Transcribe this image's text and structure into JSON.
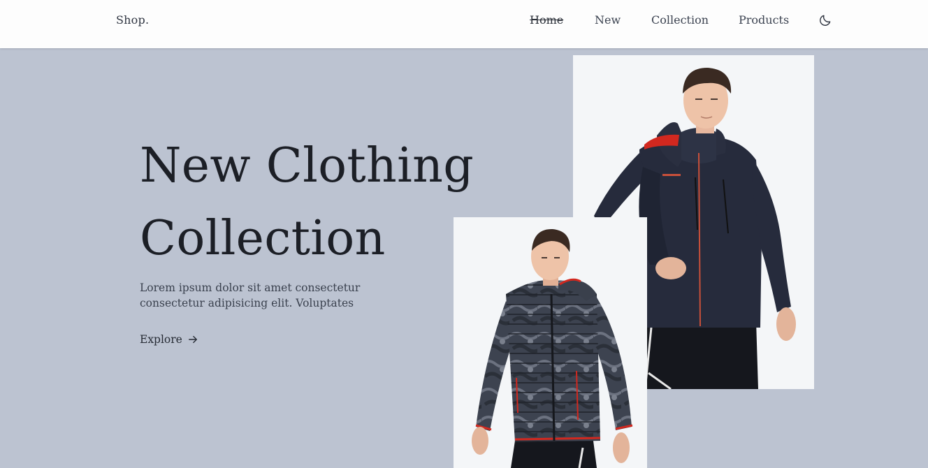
{
  "header": {
    "logo": "Shop.",
    "nav": [
      {
        "label": "Home",
        "active": true
      },
      {
        "label": "New",
        "active": false
      },
      {
        "label": "Collection",
        "active": false
      },
      {
        "label": "Products",
        "active": false
      }
    ],
    "theme_toggle_icon": "moon-icon"
  },
  "hero": {
    "title_line1": "New Clothing",
    "title_line2": "Collection",
    "description": "Lorem ipsum dolor sit amet consectetur consectetur adipisicing elit. Voluptates",
    "cta_label": "Explore",
    "cta_icon": "arrow-right-icon"
  },
  "colors": {
    "background": "#bcc3d1",
    "header_bg": "#fdfdfd",
    "photo_bg": "#f4f6f8",
    "text_dark": "#1c1f26",
    "jacket_navy": "#252a3a",
    "accent_red": "#d2281f"
  },
  "images": {
    "back_photo": "man-in-navy-ski-jacket",
    "front_photo": "man-in-camo-puffer-jacket"
  }
}
